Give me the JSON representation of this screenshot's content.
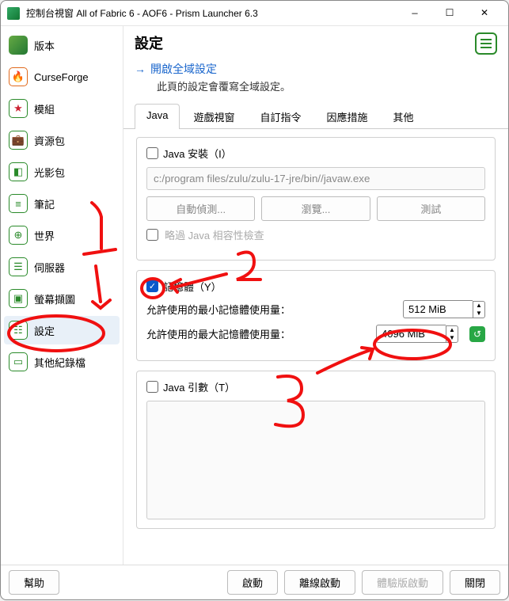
{
  "window": {
    "title": "控制台視窗 All of Fabric 6 - AOF6 - Prism Launcher 6.3"
  },
  "sidebar": {
    "items": [
      {
        "label": "版本"
      },
      {
        "label": "CurseForge"
      },
      {
        "label": "模組"
      },
      {
        "label": "資源包"
      },
      {
        "label": "光影包"
      },
      {
        "label": "筆記"
      },
      {
        "label": "世界"
      },
      {
        "label": "伺服器"
      },
      {
        "label": "螢幕擷圖"
      },
      {
        "label": "設定"
      },
      {
        "label": "其他紀錄檔"
      }
    ]
  },
  "main": {
    "title": "設定",
    "global_link": "開啟全域設定",
    "global_desc": "此頁的設定會覆寫全域設定。",
    "tabs": [
      {
        "label": "Java"
      },
      {
        "label": "遊戲視窗"
      },
      {
        "label": "自訂指令"
      },
      {
        "label": "因應措施"
      },
      {
        "label": "其他"
      }
    ],
    "java": {
      "install_label": "Java 安裝（I）",
      "path": "c:/program files/zulu/zulu-17-jre/bin//javaw.exe",
      "autodetect": "自動偵測...",
      "browse": "瀏覽...",
      "test": "測試",
      "skip_compat": "略過 Java 相容性檢查",
      "memory_label": "記憶體（Y）",
      "min_label": "允許使用的最小記憶體使用量：",
      "min_value": "512 MiB",
      "max_label": "允許使用的最大記憶體使用量：",
      "max_value": "4096 MiB",
      "args_label": "Java 引數（T）"
    }
  },
  "footer": {
    "help": "幫助",
    "launch": "啟動",
    "offline": "離線啟動",
    "demo": "體驗版啟動",
    "close": "關閉"
  }
}
